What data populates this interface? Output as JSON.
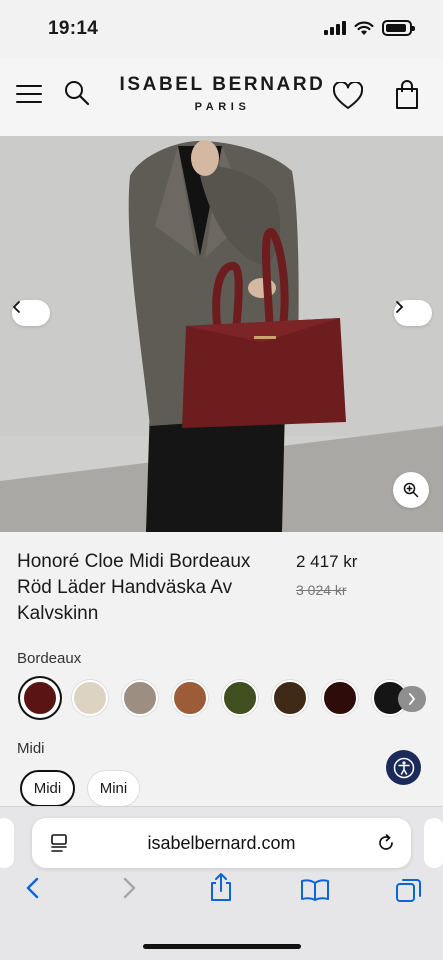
{
  "status_bar": {
    "time": "19:14"
  },
  "header": {
    "brand_name": "ISABEL BERNARD",
    "brand_sub": "PARIS"
  },
  "product": {
    "title": "Honoré Cloe Midi Bordeaux Röd Läder Handväska Av Kalvskinn",
    "price": "2 417 kr",
    "old_price": "3 024 kr",
    "color_label": "Bordeaux",
    "swatches": [
      "#5a1413",
      "#dcd3c3",
      "#9c8f81",
      "#9c5c38",
      "#3f4f1f",
      "#3e2a17",
      "#2e0c0a",
      "#151515"
    ],
    "size_label": "Midi",
    "sizes": [
      "Midi",
      "Mini"
    ]
  },
  "browser": {
    "url": "isabelbernard.com"
  },
  "colors": {
    "accent": "#0a66d8",
    "a11y_button": "#1b2a5b",
    "bag": "#6e1d1e"
  }
}
